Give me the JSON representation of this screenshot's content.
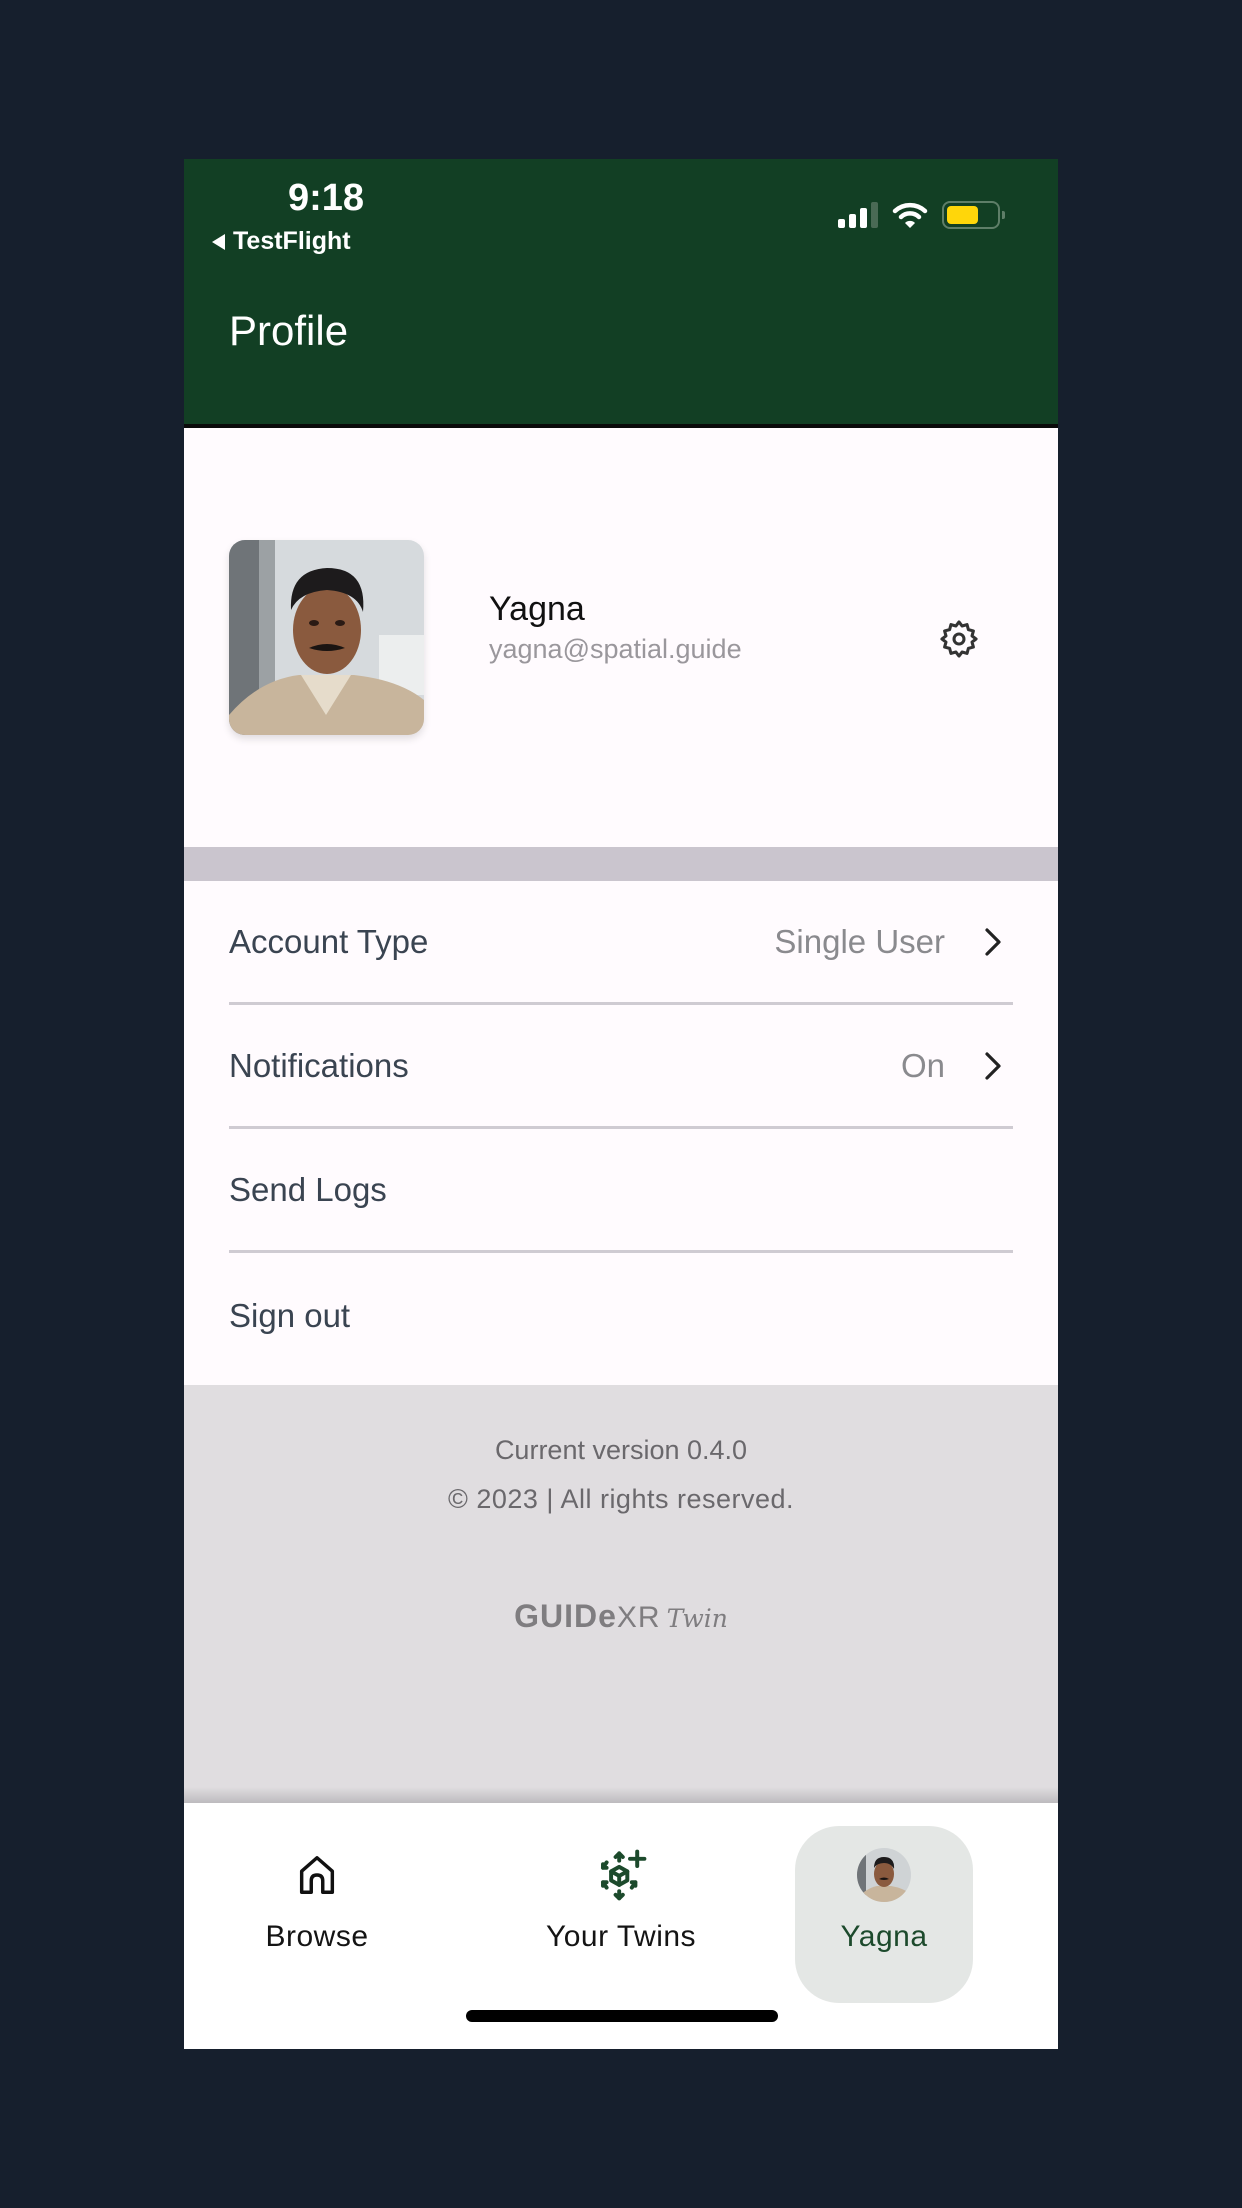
{
  "status_bar": {
    "time": "9:18",
    "back_app": "TestFlight",
    "icons": [
      "cellular-signal-icon",
      "wifi-icon",
      "battery-icon"
    ],
    "battery_level": 0.65,
    "battery_color": "#ffd60a"
  },
  "header": {
    "title": "Profile",
    "background": "#123f24"
  },
  "profile": {
    "name": "Yagna",
    "email": "yagna@spatial.guide",
    "settings_icon": "gear-icon"
  },
  "settings_list": [
    {
      "label": "Account Type",
      "value": "Single User",
      "has_chevron": true
    },
    {
      "label": "Notifications",
      "value": "On",
      "has_chevron": true
    },
    {
      "label": "Send Logs",
      "value": "",
      "has_chevron": false
    },
    {
      "label": "Sign out",
      "value": "",
      "has_chevron": false
    }
  ],
  "footer": {
    "version": "Current version 0.4.0",
    "copyright": "© 2023 | All rights reserved.",
    "logo": {
      "part1": "GUIDe",
      "part2": "XR",
      "part3": "Twin"
    }
  },
  "tab_bar": {
    "active_color": "#1c4a2c",
    "tabs": [
      {
        "label": "Browse",
        "icon": "home-icon",
        "active": false
      },
      {
        "label": "Your Twins",
        "icon": "add-twin-cube-icon",
        "active": false
      },
      {
        "label": "Yagna",
        "icon": "user-avatar",
        "active": true
      }
    ]
  }
}
